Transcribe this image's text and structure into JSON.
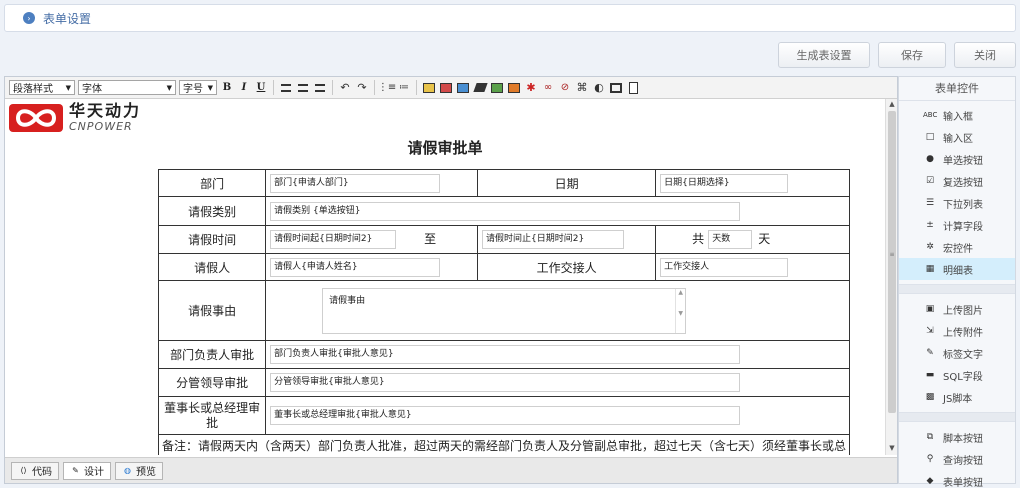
{
  "header": {
    "title": "表单设置"
  },
  "actions": {
    "generate": "生成表设置",
    "save": "保存",
    "close": "关闭"
  },
  "toolbar": {
    "paragraph_style": "段落样式",
    "font_family": "字体",
    "font_size": "字号",
    "bold": "B",
    "italic": "I",
    "underline": "U"
  },
  "logo": {
    "cn": "华天动力",
    "en": "CNPOWER"
  },
  "form": {
    "title": "请假审批单",
    "rows": {
      "dept_label": "部门",
      "dept_field": "部门{申请人部门}",
      "date_label": "日期",
      "date_field": "日期{日期选择}",
      "type_label": "请假类别",
      "type_field": "请假类别 {单选按钮}",
      "time_label": "请假时间",
      "start_field": "请假时间起{日期时间2}",
      "to": "至",
      "end_field": "请假时间止{日期时间2}",
      "total": "共",
      "days_field": "天数",
      "day_unit": "天",
      "person_label": "请假人",
      "person_field": "请假人{申请人姓名}",
      "handover_label": "工作交接人",
      "handover_field": "工作交接人",
      "reason_label": "请假事由",
      "reason_field": "请假事由",
      "dept_head_label": "部门负责人审批",
      "dept_head_field": "部门负责人审批{审批人意见}",
      "leader_label": "分管领导审批",
      "leader_field": "分管领导审批{审批人意见}",
      "chairman_label": "董事长或总经理审批",
      "chairman_field": "董事长或总经理审批{审批人意见}",
      "note": "备注：请假两天内（含两天）部门负责人批准，超过两天的需经部门负责人及分管副总审批，超过七天（含七天）须经董事长或总"
    }
  },
  "bottom_tabs": [
    "代码",
    "设计",
    "预览"
  ],
  "panel": {
    "title": "表单控件",
    "items": [
      {
        "icon": "ABC",
        "label": "输入框"
      },
      {
        "icon": "□",
        "label": "输入区"
      },
      {
        "icon": "●",
        "label": "单选按钮"
      },
      {
        "icon": "☑",
        "label": "复选按钮"
      },
      {
        "icon": "☰",
        "label": "下拉列表"
      },
      {
        "icon": "±",
        "label": "计算字段"
      },
      {
        "icon": "✲",
        "label": "宏控件"
      },
      {
        "icon": "▦",
        "label": "明细表"
      }
    ],
    "items2": [
      {
        "icon": "▣",
        "label": "上传图片"
      },
      {
        "icon": "⇲",
        "label": "上传附件"
      },
      {
        "icon": "✎",
        "label": "标签文字"
      },
      {
        "icon": "▬",
        "label": "SQL字段"
      },
      {
        "icon": "▩",
        "label": "JS脚本"
      }
    ],
    "items3": [
      {
        "icon": "⧉",
        "label": "脚本按钮"
      },
      {
        "icon": "⚲",
        "label": "查询按钮"
      },
      {
        "icon": "◆",
        "label": "表单按钮"
      }
    ]
  }
}
